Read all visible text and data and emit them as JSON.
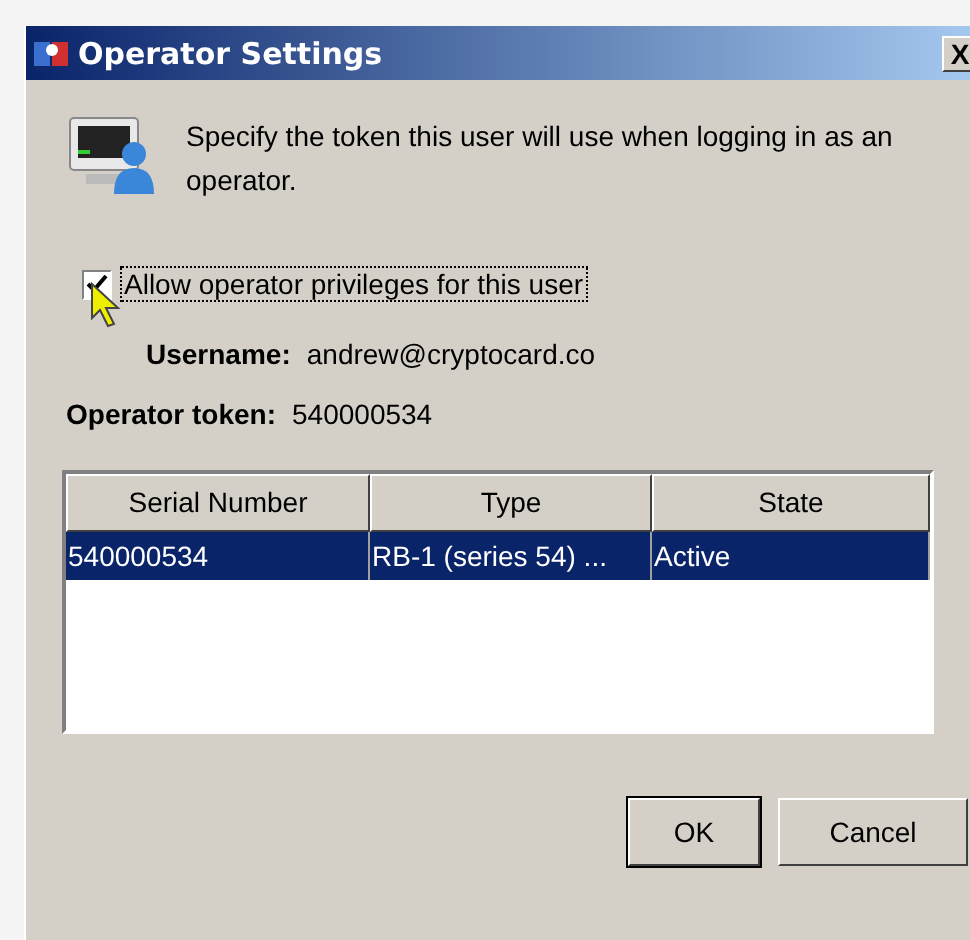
{
  "window": {
    "title": "Operator Settings",
    "close": "X"
  },
  "description": "Specify the token this user will use when logging in as an operator.",
  "allow_checkbox": {
    "label": "Allow operator privileges for this user",
    "checked": true
  },
  "username": {
    "label": "Username:",
    "value": "andrew@cryptocard.co"
  },
  "operator_token": {
    "label": "Operator token:",
    "value": "540000534"
  },
  "table": {
    "columns": [
      "Serial Number",
      "Type",
      "State"
    ],
    "rows": [
      {
        "cells": [
          "540000534",
          "RB-1 (series 54) ...",
          "Active"
        ],
        "selected": true
      }
    ]
  },
  "buttons": [
    "OK",
    "Cancel"
  ]
}
